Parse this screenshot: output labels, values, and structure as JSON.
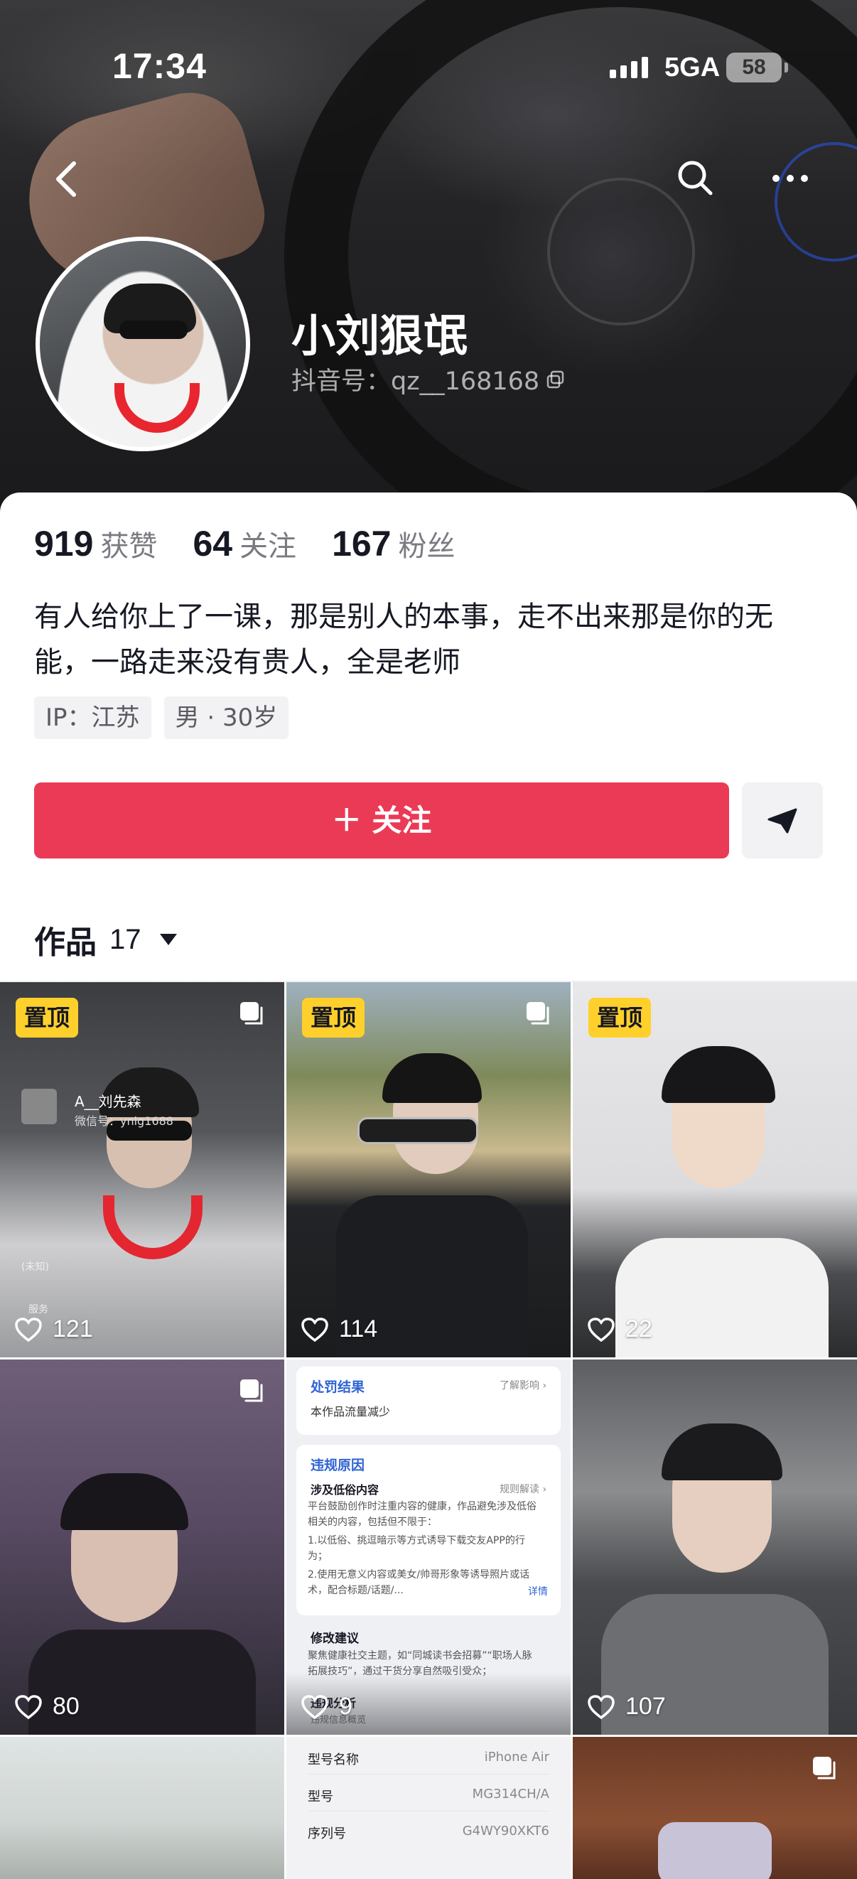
{
  "status_bar": {
    "time": "17:34",
    "network": "5GA",
    "battery": "58"
  },
  "nav": {
    "back_icon": "chevron-left-icon",
    "search_icon": "search-icon",
    "more_icon": "ellipsis-icon"
  },
  "profile": {
    "name": "小刘狠氓",
    "douyin_id": "抖音号：qz__168168",
    "stats": [
      {
        "num": "919",
        "label": "获赞"
      },
      {
        "num": "64",
        "label": "关注"
      },
      {
        "num": "167",
        "label": "粉丝"
      }
    ],
    "bio": "有人给你上了一课，那是别人的本事，走不出来那是你的无能，一路走来没有贵人，全是老师",
    "tags": [
      "IP：江苏",
      "男 · 30岁"
    ]
  },
  "actions": {
    "follow_label": "＋ 关注",
    "message_icon": "send-icon"
  },
  "works": {
    "label": "作品",
    "count": "17"
  },
  "grid": [
    {
      "pinned": "置顶",
      "likes": "121",
      "overlay_name": "A__刘先森",
      "overlay_wechat": "微信号：ynlg1688",
      "overlay_small": "(未知)",
      "overlay_service": "服务"
    },
    {
      "pinned": "置顶",
      "likes": "114"
    },
    {
      "pinned": "置顶",
      "likes": "22"
    },
    {
      "likes": "80"
    },
    {
      "likes": "9",
      "doc": {
        "result_title": "处罚结果",
        "result_link": "了解影响 ›",
        "result_text": "本作品流量减少",
        "reason_title": "违规原因",
        "reason_sub": "涉及低俗内容",
        "reason_link": "规则解读 ›",
        "reason_lines": [
          "平台鼓励创作时注重内容的健康，作品避免涉及低俗",
          "相关的内容，包括但不限于：",
          "1.以低俗、挑逗暗示等方式诱导下载交友APP的行",
          "为；",
          "2.使用无意义内容或美女/帅哥形象等诱导照片或话",
          "术，配合标题/话题/..."
        ],
        "detail": "详情",
        "advice_title": "修改建议",
        "advice_lines": [
          "聚焦健康社交主题，如“同城读书会招募”“职场人脉",
          "拓展技巧”，通过干货分享自然吸引受众；"
        ],
        "analysis_title": "违规分析",
        "analysis_sub": "违规信息概览"
      }
    },
    {
      "likes": "107"
    },
    {},
    {
      "specs": [
        {
          "k": "型号名称",
          "v": "iPhone Air"
        },
        {
          "k": "型号",
          "v": "MG314CH/A"
        },
        {
          "k": "序列号",
          "v": "G4WY90XKT6"
        }
      ]
    },
    {}
  ]
}
